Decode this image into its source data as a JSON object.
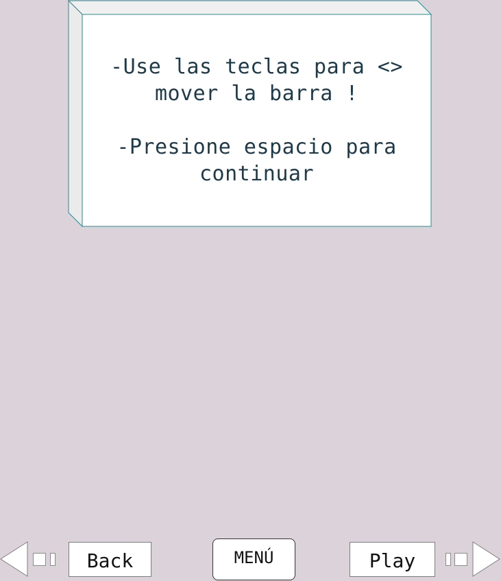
{
  "dialog": {
    "line1": "-Use las teclas para <>\nmover la barra !",
    "line2": "-Presione espacio para\ncontinuar"
  },
  "nav": {
    "back_label": "Back",
    "menu_label": "MENÚ",
    "play_label": "Play"
  },
  "colors": {
    "background": "#dcd3da",
    "box_border": "#2a8a8e",
    "text": "#1d3a48"
  }
}
